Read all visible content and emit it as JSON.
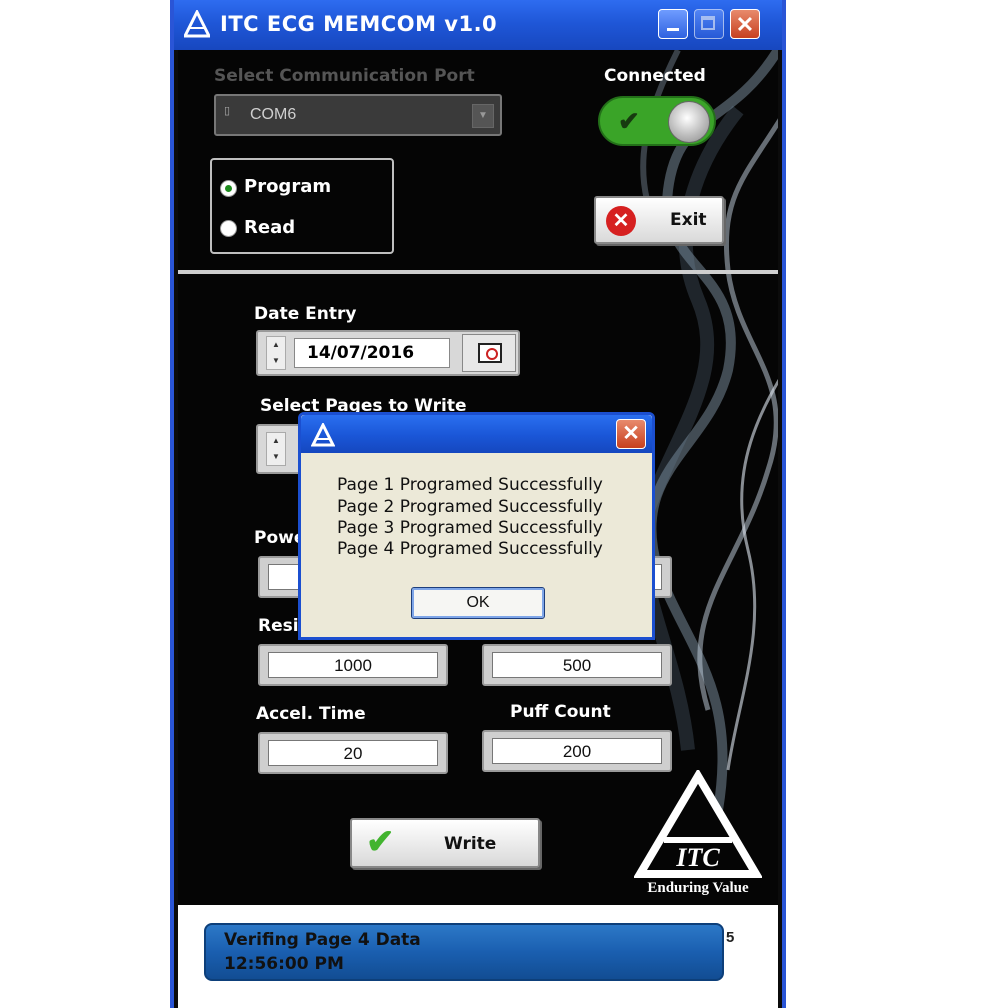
{
  "window": {
    "title": "ITC ECG MEMCOM v1.0"
  },
  "port": {
    "label": "Select Communication Port",
    "value": "COM6"
  },
  "connection": {
    "label": "Connected"
  },
  "mode": {
    "options": [
      "Program",
      "Read"
    ],
    "selected": "Program"
  },
  "exit_label": "Exit",
  "date": {
    "label": "Date Entry",
    "value": "14/07/2016"
  },
  "pages": {
    "label": "Select Pages to Write"
  },
  "labels": {
    "power_partial": "Powe",
    "resi_partial": "Resi",
    "accel_time": "Accel. Time",
    "puff_count": "Puff Count"
  },
  "fields": {
    "resistance_left": "1000",
    "resistance_right": "500",
    "accel_time": "20",
    "puff_count": "200"
  },
  "write_label": "Write",
  "logo": {
    "tagline": "Enduring Value",
    "mark_text": "ITC"
  },
  "status": {
    "line1": "Verifing Page 4 Data",
    "line2": "12:56:00 PM",
    "right_digit": "5"
  },
  "dialog": {
    "messages": [
      "Page 1 Programed Successfully",
      "Page 2 Programed Successfully",
      "Page 3 Programed Successfully",
      "Page 4 Programed Successfully"
    ],
    "ok_label": "OK"
  },
  "colors": {
    "titlebar": "#1f57d8",
    "toggle_on": "#3aa428",
    "status_bar": "#1a5fb0",
    "dialog_bg": "#ece9d8"
  }
}
